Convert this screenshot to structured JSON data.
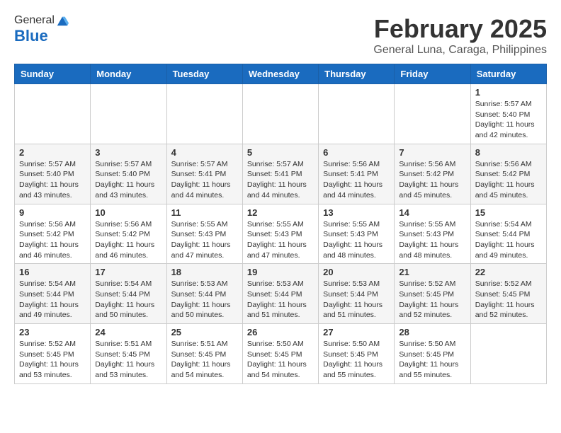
{
  "header": {
    "logo_general": "General",
    "logo_blue": "Blue",
    "month_title": "February 2025",
    "location": "General Luna, Caraga, Philippines"
  },
  "days_of_week": [
    "Sunday",
    "Monday",
    "Tuesday",
    "Wednesday",
    "Thursday",
    "Friday",
    "Saturday"
  ],
  "weeks": [
    [
      {
        "day": "",
        "info": ""
      },
      {
        "day": "",
        "info": ""
      },
      {
        "day": "",
        "info": ""
      },
      {
        "day": "",
        "info": ""
      },
      {
        "day": "",
        "info": ""
      },
      {
        "day": "",
        "info": ""
      },
      {
        "day": "1",
        "info": "Sunrise: 5:57 AM\nSunset: 5:40 PM\nDaylight: 11 hours and 42 minutes."
      }
    ],
    [
      {
        "day": "2",
        "info": "Sunrise: 5:57 AM\nSunset: 5:40 PM\nDaylight: 11 hours and 43 minutes."
      },
      {
        "day": "3",
        "info": "Sunrise: 5:57 AM\nSunset: 5:40 PM\nDaylight: 11 hours and 43 minutes."
      },
      {
        "day": "4",
        "info": "Sunrise: 5:57 AM\nSunset: 5:41 PM\nDaylight: 11 hours and 44 minutes."
      },
      {
        "day": "5",
        "info": "Sunrise: 5:57 AM\nSunset: 5:41 PM\nDaylight: 11 hours and 44 minutes."
      },
      {
        "day": "6",
        "info": "Sunrise: 5:56 AM\nSunset: 5:41 PM\nDaylight: 11 hours and 44 minutes."
      },
      {
        "day": "7",
        "info": "Sunrise: 5:56 AM\nSunset: 5:42 PM\nDaylight: 11 hours and 45 minutes."
      },
      {
        "day": "8",
        "info": "Sunrise: 5:56 AM\nSunset: 5:42 PM\nDaylight: 11 hours and 45 minutes."
      }
    ],
    [
      {
        "day": "9",
        "info": "Sunrise: 5:56 AM\nSunset: 5:42 PM\nDaylight: 11 hours and 46 minutes."
      },
      {
        "day": "10",
        "info": "Sunrise: 5:56 AM\nSunset: 5:42 PM\nDaylight: 11 hours and 46 minutes."
      },
      {
        "day": "11",
        "info": "Sunrise: 5:55 AM\nSunset: 5:43 PM\nDaylight: 11 hours and 47 minutes."
      },
      {
        "day": "12",
        "info": "Sunrise: 5:55 AM\nSunset: 5:43 PM\nDaylight: 11 hours and 47 minutes."
      },
      {
        "day": "13",
        "info": "Sunrise: 5:55 AM\nSunset: 5:43 PM\nDaylight: 11 hours and 48 minutes."
      },
      {
        "day": "14",
        "info": "Sunrise: 5:55 AM\nSunset: 5:43 PM\nDaylight: 11 hours and 48 minutes."
      },
      {
        "day": "15",
        "info": "Sunrise: 5:54 AM\nSunset: 5:44 PM\nDaylight: 11 hours and 49 minutes."
      }
    ],
    [
      {
        "day": "16",
        "info": "Sunrise: 5:54 AM\nSunset: 5:44 PM\nDaylight: 11 hours and 49 minutes."
      },
      {
        "day": "17",
        "info": "Sunrise: 5:54 AM\nSunset: 5:44 PM\nDaylight: 11 hours and 50 minutes."
      },
      {
        "day": "18",
        "info": "Sunrise: 5:53 AM\nSunset: 5:44 PM\nDaylight: 11 hours and 50 minutes."
      },
      {
        "day": "19",
        "info": "Sunrise: 5:53 AM\nSunset: 5:44 PM\nDaylight: 11 hours and 51 minutes."
      },
      {
        "day": "20",
        "info": "Sunrise: 5:53 AM\nSunset: 5:44 PM\nDaylight: 11 hours and 51 minutes."
      },
      {
        "day": "21",
        "info": "Sunrise: 5:52 AM\nSunset: 5:45 PM\nDaylight: 11 hours and 52 minutes."
      },
      {
        "day": "22",
        "info": "Sunrise: 5:52 AM\nSunset: 5:45 PM\nDaylight: 11 hours and 52 minutes."
      }
    ],
    [
      {
        "day": "23",
        "info": "Sunrise: 5:52 AM\nSunset: 5:45 PM\nDaylight: 11 hours and 53 minutes."
      },
      {
        "day": "24",
        "info": "Sunrise: 5:51 AM\nSunset: 5:45 PM\nDaylight: 11 hours and 53 minutes."
      },
      {
        "day": "25",
        "info": "Sunrise: 5:51 AM\nSunset: 5:45 PM\nDaylight: 11 hours and 54 minutes."
      },
      {
        "day": "26",
        "info": "Sunrise: 5:50 AM\nSunset: 5:45 PM\nDaylight: 11 hours and 54 minutes."
      },
      {
        "day": "27",
        "info": "Sunrise: 5:50 AM\nSunset: 5:45 PM\nDaylight: 11 hours and 55 minutes."
      },
      {
        "day": "28",
        "info": "Sunrise: 5:50 AM\nSunset: 5:45 PM\nDaylight: 11 hours and 55 minutes."
      },
      {
        "day": "",
        "info": ""
      }
    ]
  ]
}
